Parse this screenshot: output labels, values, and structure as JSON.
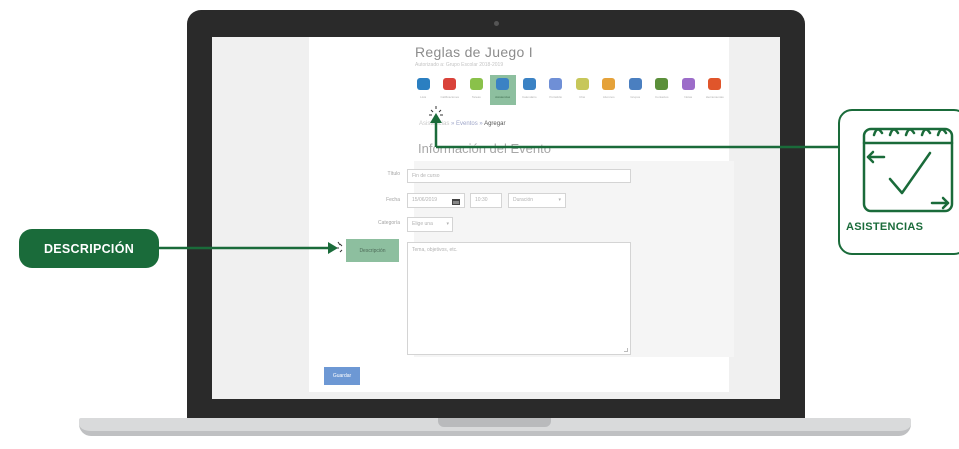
{
  "app": {
    "title": "Reglas de Juego I",
    "subtitle": "Autorizado a: Grupo Escolar 2018-2019"
  },
  "nav": {
    "items": [
      {
        "label": "Lista",
        "icon": "pencil-list-icon",
        "color": "#2b7fc1",
        "active": false
      },
      {
        "label": "Calificaciones",
        "icon": "palette-icon",
        "color": "#d9423a",
        "active": false
      },
      {
        "label": "Tareas",
        "icon": "tasks-icon",
        "color": "#8ac14a",
        "active": false
      },
      {
        "label": "Asistencias",
        "icon": "calendar-check-icon",
        "color": "#3b82c4",
        "active": true
      },
      {
        "label": "Calendario",
        "icon": "calendar-icon",
        "color": "#3b82c4",
        "active": false
      },
      {
        "label": "Portafolio",
        "icon": "pointer-icon",
        "color": "#6f8fd6",
        "active": false
      },
      {
        "label": "Chat",
        "icon": "chat-icon",
        "color": "#c7c75a",
        "active": false
      },
      {
        "label": "Alumnos",
        "icon": "user-icon",
        "color": "#e5a23a",
        "active": false
      },
      {
        "label": "Grupos",
        "icon": "group-icon",
        "color": "#4a7fc0",
        "active": false
      },
      {
        "label": "Contactos",
        "icon": "contacts-icon",
        "color": "#5b8f3a",
        "active": false
      },
      {
        "label": "Notas",
        "icon": "notes-icon",
        "color": "#9c6cc9",
        "active": false
      },
      {
        "label": "Herramientas",
        "icon": "tools-icon",
        "color": "#e0552b",
        "active": false
      }
    ]
  },
  "breadcrumb": {
    "root": "Asistencias",
    "sep1": "»",
    "middle": "Eventos",
    "sep2": "»",
    "current": "Agregar"
  },
  "form": {
    "heading": "Información del Evento",
    "title_label": "Título",
    "title_value": "Fin de curso",
    "date_label": "Fecha",
    "date_value": "15/06/2019",
    "time_value": "10:30",
    "duration_placeholder": "Duración",
    "category_label": "Categoría",
    "category_placeholder": "Elige una",
    "description_label": "Descripción",
    "description_placeholder": "Tema, objetivos, etc.",
    "save_label": "Guardar"
  },
  "callouts": {
    "description": "DESCRIPCIÓN",
    "attendance": "ASISTENCIAS"
  },
  "colors": {
    "accent_green": "#1a6b3a",
    "active_tab": "#8dbf9f",
    "save_button": "#6d98d4"
  }
}
